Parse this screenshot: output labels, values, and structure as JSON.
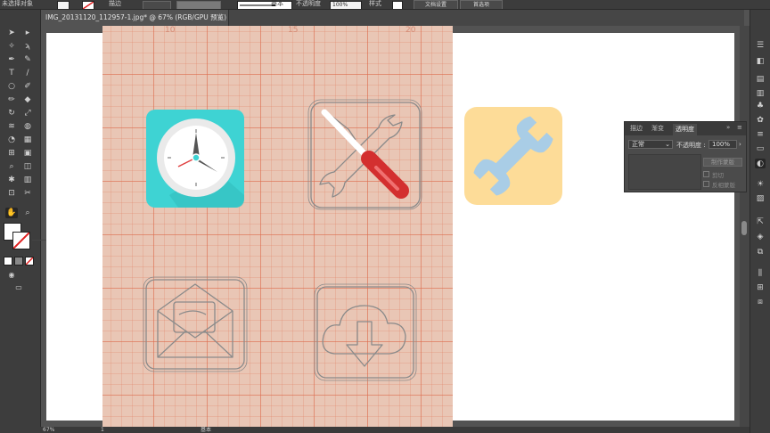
{
  "control_bar": {
    "object_label": "未选择对象",
    "stroke_label": "描边",
    "brush_label": "基本",
    "opacity_label": "不透明度",
    "opacity_value": "100%",
    "style_label": "样式",
    "doc_setup_button": "文档设置",
    "preferences_button": "首选项"
  },
  "document": {
    "tab_title": "IMG_20131120_112957-1.jpg* @ 67% (RGB/GPU 预览)",
    "close_glyph": "×",
    "paper_numbers": [
      "10",
      "15",
      "20"
    ]
  },
  "status_bar": {
    "zoom": "67%",
    "page": "1",
    "mode": "基本"
  },
  "transparency_panel": {
    "tabs": [
      "描边",
      "渐变",
      "透明度"
    ],
    "blend_mode": "正常",
    "opacity_label": "不透明度 :",
    "opacity_value": "100%",
    "make_mask_button": "制作蒙版",
    "clip_label": "剪切",
    "invert_mask_label": "反相蒙版",
    "menu_glyph": "≡",
    "collapse_glyph": "»"
  },
  "colors": {
    "compass_bg": "#3ed3d3",
    "wrench_tile": "#fddc98",
    "wrench_icon": "#a9cde6",
    "screwdriver_handle": "#d32f2f",
    "app_bg": "#535353"
  },
  "icons": {
    "tools": [
      "selection-icon",
      "direct-selection-icon",
      "magic-wand-icon",
      "lasso-icon",
      "pen-icon",
      "curvature-icon",
      "type-icon",
      "line-icon",
      "ellipse-icon",
      "brush-icon",
      "pencil-icon",
      "eraser-icon",
      "rotate-icon",
      "scale-icon",
      "width-icon",
      "warp-icon",
      "shape-builder-icon",
      "perspective-icon",
      "mesh-icon",
      "gradient-icon",
      "eyedropper-icon",
      "blend-icon",
      "symbol-sprayer-icon",
      "graph-icon",
      "artboard-icon",
      "slice-icon",
      "hand-icon",
      "zoom-icon"
    ]
  }
}
